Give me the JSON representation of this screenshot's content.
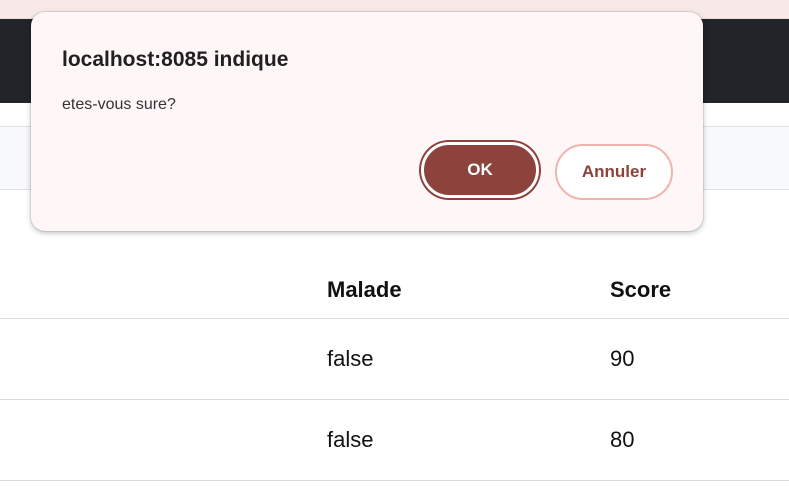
{
  "dialog": {
    "title": "localhost:8085 indique",
    "message": "etes-vous sure?",
    "ok_label": "OK",
    "cancel_label": "Annuler"
  },
  "table": {
    "headers": [
      "",
      "Malade",
      "Score"
    ],
    "rows": [
      [
        "",
        "false",
        "90"
      ],
      [
        "",
        "false",
        "80"
      ]
    ]
  },
  "colors": {
    "navbar": "#212529",
    "accent": "#8b433c",
    "dialog_background": "#fff6f7"
  }
}
